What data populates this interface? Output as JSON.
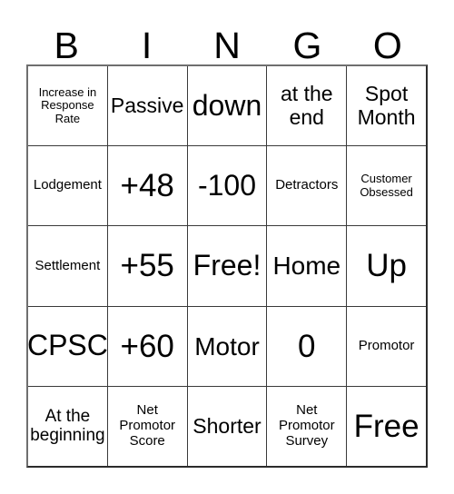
{
  "card": {
    "title": "BINGO",
    "header_letters": [
      "B",
      "I",
      "N",
      "G",
      "O"
    ],
    "rows": [
      [
        {
          "text": "Increase in Response Rate",
          "size": "xs"
        },
        {
          "text": "Passive",
          "size": "l"
        },
        {
          "text": "down",
          "size": "xxl"
        },
        {
          "text": "at the end",
          "size": "l"
        },
        {
          "text": "Spot Month",
          "size": "l"
        }
      ],
      [
        {
          "text": "Lodgement",
          "size": "s"
        },
        {
          "text": "+48",
          "size": "max"
        },
        {
          "text": "-100",
          "size": "xxl"
        },
        {
          "text": "Detractors",
          "size": "s"
        },
        {
          "text": "Customer Obsessed",
          "size": "xs"
        }
      ],
      [
        {
          "text": "Settlement",
          "size": "s"
        },
        {
          "text": "+55",
          "size": "max"
        },
        {
          "text": "Free!",
          "size": "xxl"
        },
        {
          "text": "Home",
          "size": "xl"
        },
        {
          "text": "Up",
          "size": "max"
        }
      ],
      [
        {
          "text": "CPSC",
          "size": "xxl"
        },
        {
          "text": "+60",
          "size": "max"
        },
        {
          "text": "Motor",
          "size": "xl"
        },
        {
          "text": "0",
          "size": "max"
        },
        {
          "text": "Promotor",
          "size": "s"
        }
      ],
      [
        {
          "text": "At the beginning",
          "size": "m"
        },
        {
          "text": "Net Promotor Score",
          "size": "s"
        },
        {
          "text": "Shorter",
          "size": "l"
        },
        {
          "text": "Net Promotor Survey",
          "size": "s"
        },
        {
          "text": "Free",
          "size": "max"
        }
      ]
    ],
    "free_space": {
      "row": 2,
      "column": 2,
      "label": "Free!"
    },
    "colors": {
      "background": "#ffffff",
      "text": "#000000",
      "grid_line": "#3a3a3a",
      "border": "#2b2b2b"
    }
  }
}
